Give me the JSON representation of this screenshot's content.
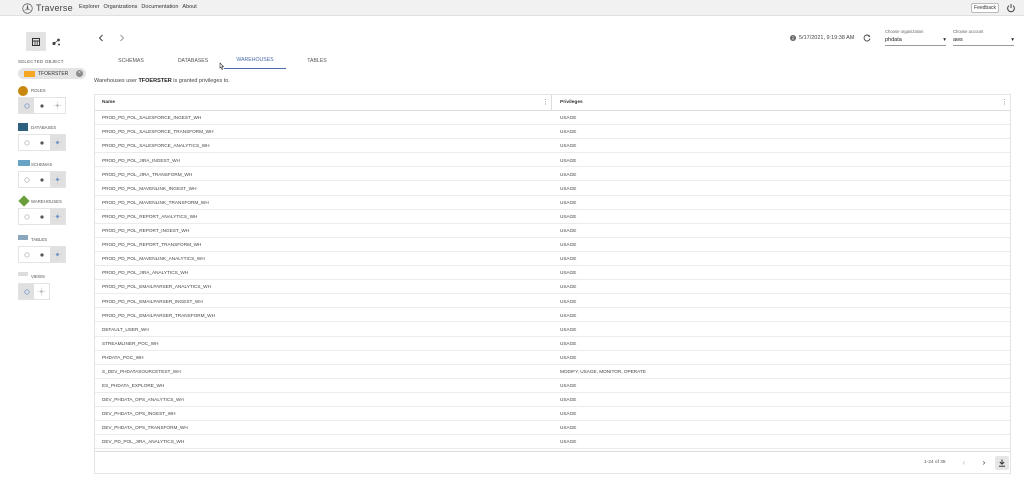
{
  "app": {
    "name": "Traverse"
  },
  "nav": [
    "Explorer",
    "Organizations",
    "Documentation",
    "About"
  ],
  "topbar": {
    "feedback_label": "Feedback"
  },
  "sidebar": {
    "selected_label": "SELECTED OBJECT",
    "selected_object": "TFOERSTER",
    "legend": [
      {
        "label": "ROLES",
        "color": "#c8870f",
        "active_mode": 0
      },
      {
        "label": "DATABASES",
        "color": "#2e5f7f",
        "active_mode": 2
      },
      {
        "label": "SCHEMAS",
        "color": "#6aa3c4",
        "active_mode": 2
      },
      {
        "label": "WAREHOUSES",
        "color": "#6b9e3a",
        "active_mode": 2
      },
      {
        "label": "TABLES",
        "color": "#8ba7bd",
        "active_mode": 2
      },
      {
        "label": "VIEWS",
        "color": "#dddddd",
        "active_mode": 0
      }
    ]
  },
  "header": {
    "timestamp": "5/17/2021, 9:19:38 AM",
    "org_caption": "Choose organization",
    "org_value": "phdata",
    "account_caption": "Choose account",
    "account_value": "aws"
  },
  "tabs": [
    {
      "label": "SCHEMAS",
      "active": false
    },
    {
      "label": "DATABASES",
      "active": false
    },
    {
      "label": "WAREHOUSES",
      "active": true
    },
    {
      "label": "TABLES",
      "active": false
    }
  ],
  "description": {
    "prefix": "Warehouses user",
    "user": "TFOERSTER",
    "suffix": "is granted privileges to."
  },
  "table": {
    "columns": [
      "Name",
      "Privileges"
    ],
    "rows": [
      [
        "PROD_PD_POL_SALESFORCE_INGEST_WH",
        "USAGE"
      ],
      [
        "PROD_PD_POL_SALESFORCE_TRANSFORM_WH",
        "USAGE"
      ],
      [
        "PROD_PD_POL_SALESFORCE_ANALYTICS_WH",
        "USAGE"
      ],
      [
        "PROD_PD_POL_JIRA_INGEST_WH",
        "USAGE"
      ],
      [
        "PROD_PD_POL_JIRA_TRANSFORM_WH",
        "USAGE"
      ],
      [
        "PROD_PD_POL_MAVENLINK_INGEST_WH",
        "USAGE"
      ],
      [
        "PROD_PD_POL_MAVENLINK_TRANSFORM_WH",
        "USAGE"
      ],
      [
        "PROD_PD_POL_REPORT_ANALYTICS_WH",
        "USAGE"
      ],
      [
        "PROD_PD_POL_REPORT_INGEST_WH",
        "USAGE"
      ],
      [
        "PROD_PD_POL_REPORT_TRANSFORM_WH",
        "USAGE"
      ],
      [
        "PROD_PD_POL_MAVENLINK_ANALYTICS_WH",
        "USAGE"
      ],
      [
        "PROD_PD_POL_JIRA_ANALYTICS_WH",
        "USAGE"
      ],
      [
        "PROD_PD_POL_EMAILPARSER_ANALYTICS_WH",
        "USAGE"
      ],
      [
        "PROD_PD_POL_EMAILPARSER_INGEST_WH",
        "USAGE"
      ],
      [
        "PROD_PD_POL_EMAILPARSER_TRANSFORM_WH",
        "USAGE"
      ],
      [
        "DEFAULT_USER_WH",
        "USAGE"
      ],
      [
        "STREAMLINER_POC_WH",
        "USAGE"
      ],
      [
        "PHDATA_POC_WH",
        "USAGE"
      ],
      [
        "S_DEV_PHDATASOURCETEST_WH",
        "MODIFY, USAGE, MONITOR, OPERATE"
      ],
      [
        "ES_PHDATA_EXPLORE_WH",
        "USAGE"
      ],
      [
        "DEV_PHDATA_OPS_ANALYTICS_WH",
        "USAGE"
      ],
      [
        "DEV_PHDATA_OPS_INGEST_WH",
        "USAGE"
      ],
      [
        "DEV_PHDATA_OPS_TRANSFORM_WH",
        "USAGE"
      ],
      [
        "DEV_PD_POL_JIRA_ANALYTICS_WH",
        "USAGE"
      ]
    ]
  },
  "pagination": {
    "info": "1-24 of 35"
  }
}
